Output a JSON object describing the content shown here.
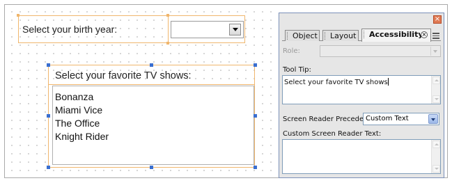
{
  "form": {
    "birth_year_label": "Select your birth year:",
    "birth_year_value": "",
    "tv_shows_label": "Select your favorite TV shows:",
    "tv_shows_items": [
      "Bonanza",
      "Miami Vice",
      "The Office",
      "Knight Rider"
    ]
  },
  "panel": {
    "close_glyph": "×",
    "tabs": [
      {
        "label": "Object"
      },
      {
        "label": "Layout"
      },
      {
        "label": "Accessibility"
      }
    ],
    "role_label": "Role:",
    "role_value": "",
    "tooltip_label": "Tool Tip:",
    "tooltip_value": "Select your favorite TV shows",
    "precedence_label": "Screen Reader Precedence:",
    "precedence_value": "Custom Text",
    "custom_text_label": "Custom Screen Reader Text:",
    "custom_text_value": ""
  },
  "colors": {
    "selection_border": "#f0b66d",
    "selection_handle": "#3a6fd0",
    "panel_background": "#e6e6e6",
    "close_button": "#e07a54"
  }
}
